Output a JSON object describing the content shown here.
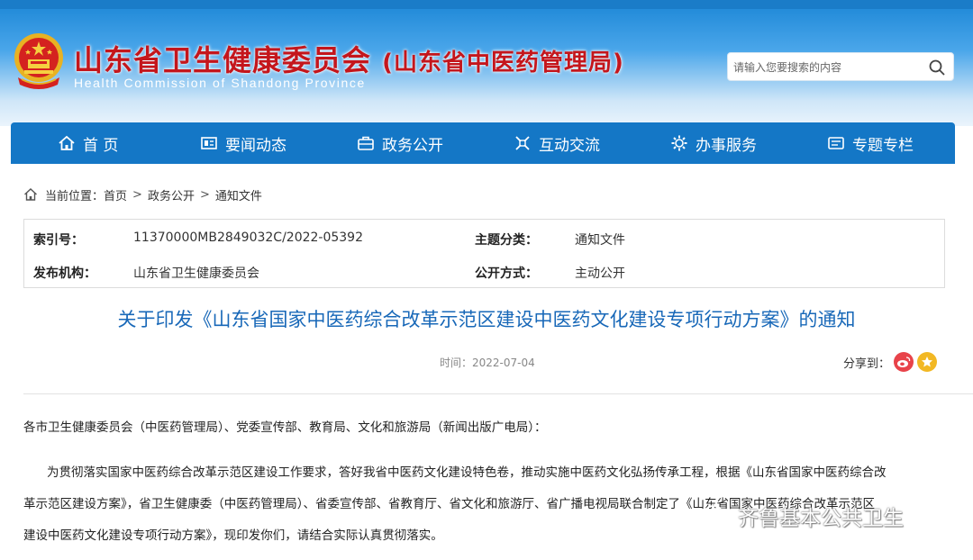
{
  "header": {
    "title": "山东省卫生健康委员会",
    "title_sub": "(山东省中医药管理局)",
    "title_en": "Health Commission of Shandong Province",
    "search_placeholder": "请输入您要搜索的内容"
  },
  "nav": {
    "items": [
      {
        "label": "首 页",
        "icon": "home-icon"
      },
      {
        "label": "要闻动态",
        "icon": "news-icon"
      },
      {
        "label": "政务公开",
        "icon": "briefcase-icon"
      },
      {
        "label": "互动交流",
        "icon": "interact-icon"
      },
      {
        "label": "办事服务",
        "icon": "service-icon"
      },
      {
        "label": "专题专栏",
        "icon": "column-icon"
      }
    ]
  },
  "breadcrumb": {
    "label": "当前位置：",
    "items": [
      "首页",
      "政务公开",
      "通知文件"
    ],
    "separator": ">"
  },
  "meta": {
    "index_label": "索引号：",
    "index_value": "11370000MB2849032C/2022-05392",
    "topic_label": "主题分类：",
    "topic_value": "通知文件",
    "publisher_label": "发布机构：",
    "publisher_value": "山东省卫生健康委员会",
    "public_label": "公开方式：",
    "public_value": "主动公开"
  },
  "article": {
    "title": "关于印发《山东省国家中医药综合改革示范区建设中医药文化建设专项行动方案》的通知",
    "time": "时间：2022-07-04",
    "share_label": "分享到：",
    "recipients": "各市卫生健康委员会（中医药管理局）、党委宣传部、教育局、文化和旅游局（新闻出版广电局）：",
    "para_line1": "为贯彻落实国家中医药综合改革示范区建设工作要求，答好我省中医药文化建设特色卷，推动实施中医药文化弘扬传承工程，根据《山东省国家中医药综合改",
    "para_line2": "革示范区建设方案》，省卫生健康委（中医药管理局）、省委宣传部、省教育厅、省文化和旅游厅、省广播电视局联合制定了《山东省国家中医药综合改革示范区",
    "para_line3": "建设中医药文化建设专项行动方案》，现印发你们，请结合实际认真贯彻落实。"
  },
  "watermark": "齐鲁基本公共卫生",
  "colors": {
    "nav_bg": "#1477c6",
    "title_red": "#c4161c",
    "article_title": "#1868b8"
  }
}
